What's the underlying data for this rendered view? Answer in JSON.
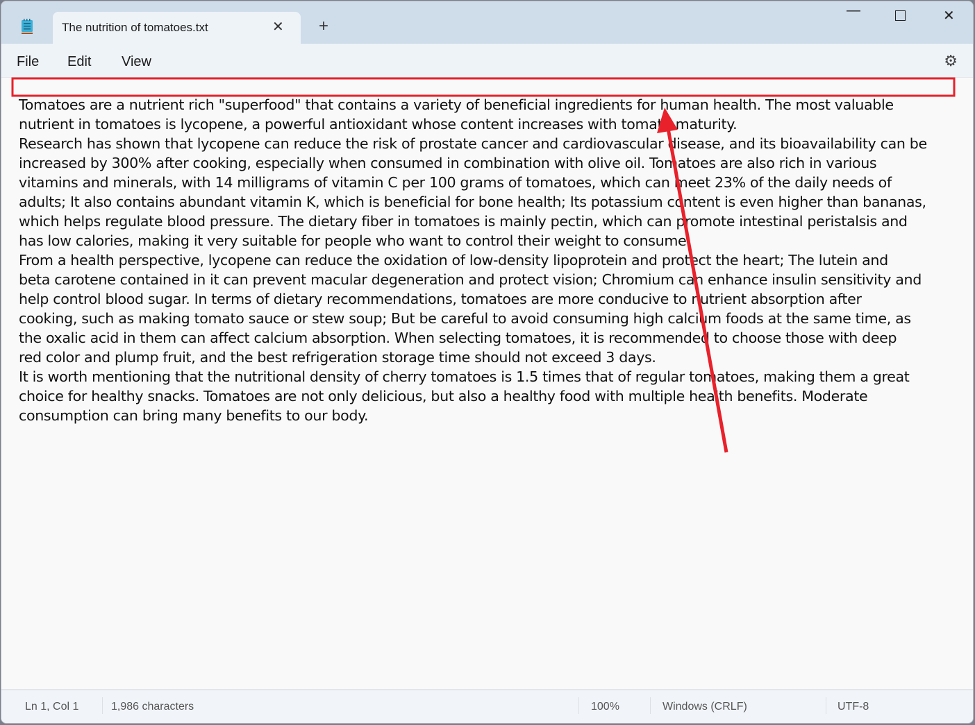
{
  "window": {
    "tab_title": "The nutrition of tomatoes.txt"
  },
  "menu": {
    "file": "File",
    "edit": "Edit",
    "view": "View"
  },
  "editor": {
    "lines": [
      "Tomatoes are a nutrient rich \"superfood\" that contains a variety of beneficial ingredients for human health. The most valuable",
      "nutrient in tomatoes is lycopene, a powerful antioxidant whose content increases with tomato maturity.",
      "Research has shown that lycopene can reduce the risk of prostate cancer and cardiovascular disease, and its bioavailability can be",
      "increased by 300% after cooking, especially when consumed in combination with olive oil. Tomatoes are also rich in various",
      "vitamins and minerals, with 14 milligrams of vitamin C per 100 grams of tomatoes, which can meet 23% of the daily needs of",
      "adults; It also contains abundant vitamin K, which is beneficial for bone health; Its potassium content is even higher than bananas,",
      "which helps regulate blood pressure. The dietary fiber in tomatoes is mainly pectin, which can promote intestinal peristalsis and",
      "has low calories, making it very suitable for people who want to control their weight to consume.",
      "From a health perspective, lycopene can reduce the oxidation of low-density lipoprotein and protect the heart; The lutein and",
      "beta carotene contained in it can prevent macular degeneration and protect vision; Chromium can enhance insulin sensitivity and",
      "help control blood sugar. In terms of dietary recommendations, tomatoes are more conducive to nutrient absorption after",
      "cooking, such as making tomato sauce or stew soup; But be careful to avoid consuming high calcium foods at the same time, as",
      "the oxalic acid in them can affect calcium absorption. When selecting tomatoes, it is recommended to choose those with deep",
      "red color and plump fruit, and the best refrigeration storage time should not exceed 3 days.",
      "It is worth mentioning that the nutritional density of cherry tomatoes is 1.5 times that of regular tomatoes, making them a great",
      "choice for healthy snacks. Tomatoes are not only delicious, but also a healthy food with multiple health benefits. Moderate",
      "consumption can bring many benefits to our body."
    ]
  },
  "status": {
    "position": "Ln 1, Col 1",
    "characters": "1,986 characters",
    "zoom": "100%",
    "line_ending": "Windows (CRLF)",
    "encoding": "UTF-8"
  },
  "colors": {
    "annotation": "#e8212b",
    "accent": "#cfdcea"
  }
}
